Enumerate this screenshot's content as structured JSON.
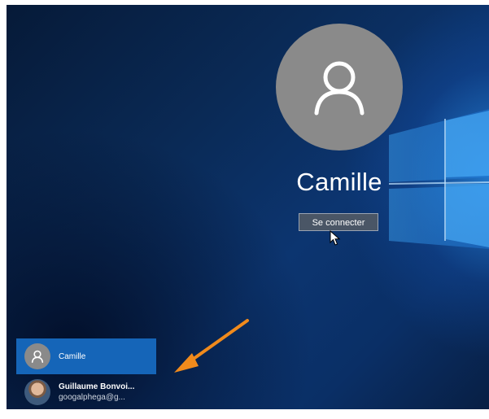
{
  "lockscreen": {
    "username": "Camille",
    "signin_button": "Se connecter"
  },
  "user_list": {
    "items": [
      {
        "name": "Camille",
        "email": "",
        "avatar": "person-icon",
        "selected": true
      },
      {
        "name": "Guillaume Bonvoi...",
        "email": "googalphega@g...",
        "avatar": "profile-photo",
        "selected": false
      }
    ]
  },
  "annotation": {
    "arrow_color": "#f08a1c"
  },
  "colors": {
    "avatar_gray": "#8a8a8a",
    "selected_user_blue": "#1565b8",
    "background_dark_blue": "#0a2a56"
  }
}
